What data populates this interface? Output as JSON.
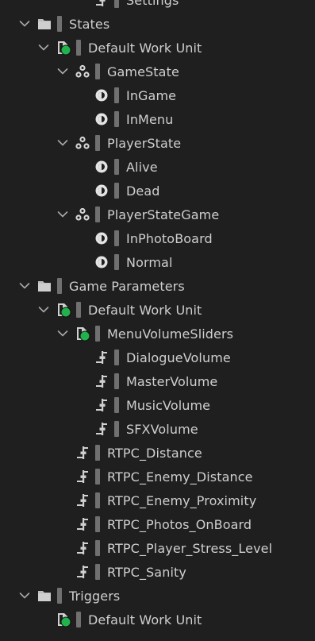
{
  "tree": {
    "partial_top_label": "Settings",
    "states_header": "States",
    "states_workunit": "Default Work Unit",
    "gamestate_group": "GameState",
    "gamestate_ingame": "InGame",
    "gamestate_inmenu": "InMenu",
    "playerstate_group": "PlayerState",
    "playerstate_alive": "Alive",
    "playerstate_dead": "Dead",
    "playerstategame_group": "PlayerStateGame",
    "playerstategame_inphotoboard": "InPhotoBoard",
    "playerstategame_normal": "Normal",
    "gameparams_header": "Game Parameters",
    "gameparams_workunit": "Default Work Unit",
    "menuvolumesliders_group": "MenuVolumeSliders",
    "dialoguevolume": "DialogueVolume",
    "mastervolume": "MasterVolume",
    "musicvolume": "MusicVolume",
    "sfxvolume": "SFXVolume",
    "rtpc_distance": "RTPC_Distance",
    "rtpc_enemy_distance": "RTPC_Enemy_Distance",
    "rtpc_enemy_proximity": "RTPC_Enemy_Proximity",
    "rtpc_photos_onboard": "RTPC_Photos_OnBoard",
    "rtpc_player_stress_level": "RTPC_Player_Stress_Level",
    "rtpc_sanity": "RTPC_Sanity",
    "triggers_header": "Triggers",
    "triggers_workunit": "Default Work Unit"
  },
  "colors": {
    "background": "#1f1f1f",
    "text": "#cfcfcf",
    "accent_green": "#22b14c"
  },
  "icons": {
    "folder": "folder-icon",
    "work_unit": "work-unit-icon",
    "state_group": "state-group-icon",
    "state": "state-icon",
    "game_parameter": "game-parameter-icon",
    "chevron": "chevron-down-icon"
  }
}
